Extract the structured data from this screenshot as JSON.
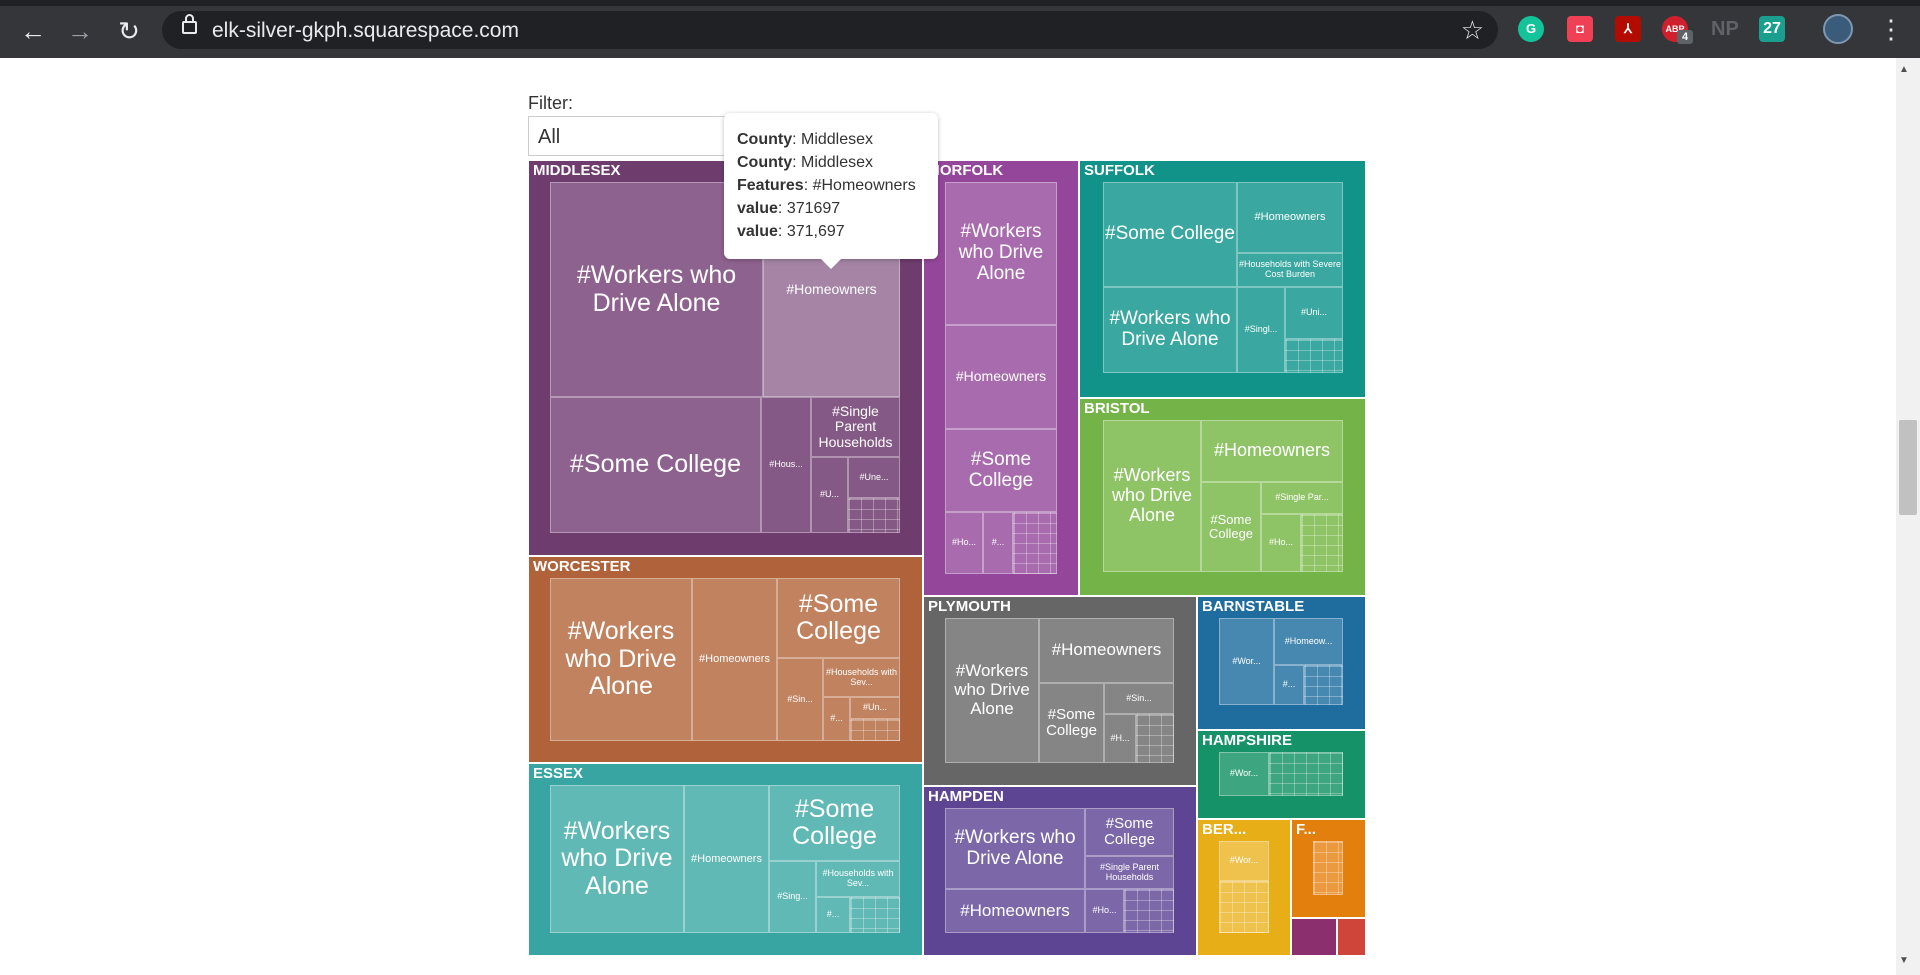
{
  "browser": {
    "url": "elk-silver-gkph.squarespace.com",
    "back_glyph": "←",
    "forward_glyph": "→",
    "reload_glyph": "↻",
    "star_glyph": "☆",
    "menu_glyph": "⋮",
    "extensions": [
      {
        "name": "grammarly-icon",
        "label": "G",
        "color": "#15c39a"
      },
      {
        "name": "pocket-icon",
        "label": "◘",
        "color": "#ef4056"
      },
      {
        "name": "pdf-icon",
        "label": "⅄",
        "color": "#b30b00"
      },
      {
        "name": "adblock-icon",
        "label": "ABP",
        "color": "#d0202d",
        "badge": "4"
      },
      {
        "name": "np-icon",
        "label": "NP",
        "color": "#5f6368"
      },
      {
        "name": "27-icon",
        "label": "27",
        "color": "#1a9e8e"
      }
    ]
  },
  "filter": {
    "label": "Filter:",
    "value": "All"
  },
  "tooltip": {
    "rows": [
      {
        "key": "County",
        "value": "Middlesex"
      },
      {
        "key": "County",
        "value": "Middlesex"
      },
      {
        "key": "Features",
        "value": "#Homeowners"
      },
      {
        "key": "value",
        "value": "371697"
      },
      {
        "key": "value",
        "value": "371,697"
      }
    ]
  },
  "treemap": {
    "counties": [
      {
        "id": "middlesex",
        "label": "MIDDLESEX",
        "color": "#6e3d6e"
      },
      {
        "id": "norfolk",
        "label": "NORFOLK",
        "color": "#94479a"
      },
      {
        "id": "suffolk",
        "label": "SUFFOLK",
        "color": "#12938a"
      },
      {
        "id": "bristol",
        "label": "BRISTOL",
        "color": "#74b347"
      },
      {
        "id": "worcester",
        "label": "WORCESTER",
        "color": "#b0623a"
      },
      {
        "id": "plymouth",
        "label": "PLYMOUTH",
        "color": "#666666"
      },
      {
        "id": "barnstable",
        "label": "BARNSTABLE",
        "color": "#1f6d9e"
      },
      {
        "id": "hampshire",
        "label": "HAMPSHIRE",
        "color": "#159267"
      },
      {
        "id": "essex",
        "label": "ESSEX",
        "color": "#39a5a2"
      },
      {
        "id": "hampden",
        "label": "HAMPDEN",
        "color": "#5e4594"
      },
      {
        "id": "berkshire",
        "label": "BER...",
        "color": "#e8ae18"
      },
      {
        "id": "franklin",
        "label": "F...",
        "color": "#e37f0d"
      }
    ],
    "cells": {
      "middlesex": [
        "#Workers who Drive Alone",
        "#Homeowners",
        "#Some College",
        "#Single Parent Households",
        "#Hous...",
        "#Une...",
        "#U..."
      ],
      "norfolk": [
        "#Workers who Drive Alone",
        "#Homeowners",
        "#Some College",
        "#Ho...",
        "#..."
      ],
      "suffolk": [
        "#Some College",
        "#Homeowners",
        "#Households with Severe Cost Burden",
        "#Workers who Drive Alone",
        "#Uni...",
        "#Singl..."
      ],
      "bristol": [
        "#Workers who Drive Alone",
        "#Homeowners",
        "#Single Par...",
        "#Some College",
        "#Ho..."
      ],
      "worcester": [
        "#Workers who Drive Alone",
        "#Homeowners",
        "#Some College",
        "#Households with Sev...",
        "#Sin...",
        "#Un...",
        "#..."
      ],
      "plymouth": [
        "#Workers who Drive Alone",
        "#Homeowners",
        "#Some College",
        "#Sin...",
        "#H..."
      ],
      "barnstable": [
        "#Homeow...",
        "#Wor...",
        "#..."
      ],
      "hampshire": [
        "#Wor..."
      ],
      "essex": [
        "#Workers who Drive Alone",
        "#Homeowners",
        "#Some College",
        "#Households with Sev...",
        "#Sing...",
        "#..."
      ],
      "hampden": [
        "#Workers who Drive Alone",
        "#Some College",
        "#Single Parent Households",
        "#Homeowners",
        "#Ho..."
      ],
      "berkshire": [
        "#Wor..."
      ]
    }
  }
}
